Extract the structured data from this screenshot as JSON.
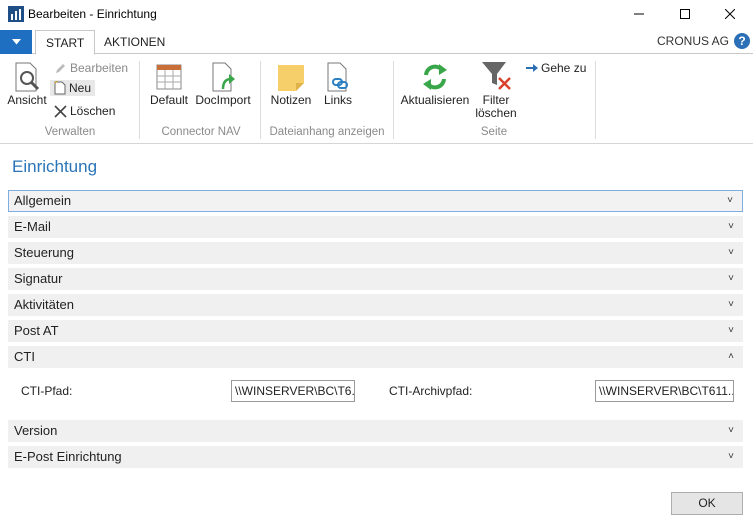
{
  "window": {
    "title": "Bearbeiten - Einrichtung"
  },
  "tabs": {
    "start": "START",
    "actions": "AKTIONEN"
  },
  "company": "CRONUS AG",
  "ribbon": {
    "verwalten": {
      "label": "Verwalten",
      "ansicht": "Ansicht",
      "bearbeiten": "Bearbeiten",
      "neu": "Neu",
      "loeschen": "Löschen"
    },
    "connector": {
      "label": "Connector NAV",
      "default": "Default",
      "docimport": "DocImport"
    },
    "dateianhang": {
      "label": "Dateianhang anzeigen",
      "notizen": "Notizen",
      "links": "Links"
    },
    "seite": {
      "label": "Seite",
      "aktualisieren": "Aktualisieren",
      "filter_line1": "Filter",
      "filter_line2": "löschen",
      "gehe_zu": "Gehe zu"
    }
  },
  "page": {
    "title": "Einrichtung"
  },
  "sections": {
    "allgemein": "Allgemein",
    "email": "E-Mail",
    "steuerung": "Steuerung",
    "signatur": "Signatur",
    "aktivitaeten": "Aktivitäten",
    "post_at": "Post AT",
    "cti": "CTI",
    "version": "Version",
    "epost": "E-Post Einrichtung"
  },
  "cti": {
    "pfad_label": "CTI-Pfad:",
    "pfad_value": "\\\\WINSERVER\\BC\\T6...",
    "archiv_label": "CTI-Archivpfad:",
    "archiv_value": "\\\\WINSERVER\\BC\\T611..."
  },
  "ok_label": "OK",
  "icons": {
    "app": "app-logo-icon",
    "minimize": "minimize-icon",
    "maximize": "maximize-icon",
    "close": "close-icon"
  },
  "colors": {
    "accent": "#1e6fc2",
    "title_blue": "#2a74b8",
    "refresh_green": "#3aa64a",
    "filter_red": "#d9402b"
  }
}
